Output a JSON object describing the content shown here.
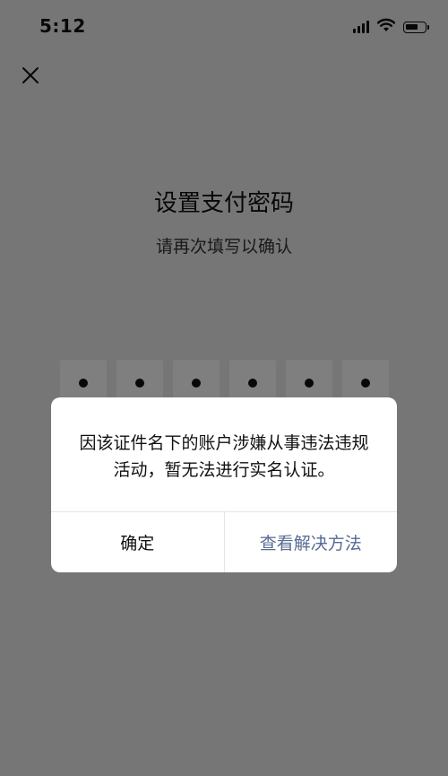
{
  "status_bar": {
    "time": "5:12",
    "battery_level": 0.7
  },
  "icons": {
    "close": "close-icon",
    "signal": "signal-icon",
    "wifi": "wifi-icon",
    "battery": "battery-icon"
  },
  "page": {
    "title": "设置支付密码",
    "subtitle": "请再次填写以确认",
    "pin_length": 6,
    "pin_filled": 6
  },
  "dialog": {
    "message": "因该证件名下的账户涉嫌从事违法违规活动，暂无法进行实名认证。",
    "confirm_label": "确定",
    "solution_label": "查看解决方法"
  },
  "colors": {
    "link": "#576b95",
    "background": "#ededed",
    "overlay": "rgba(0,0,0,0.5)"
  }
}
